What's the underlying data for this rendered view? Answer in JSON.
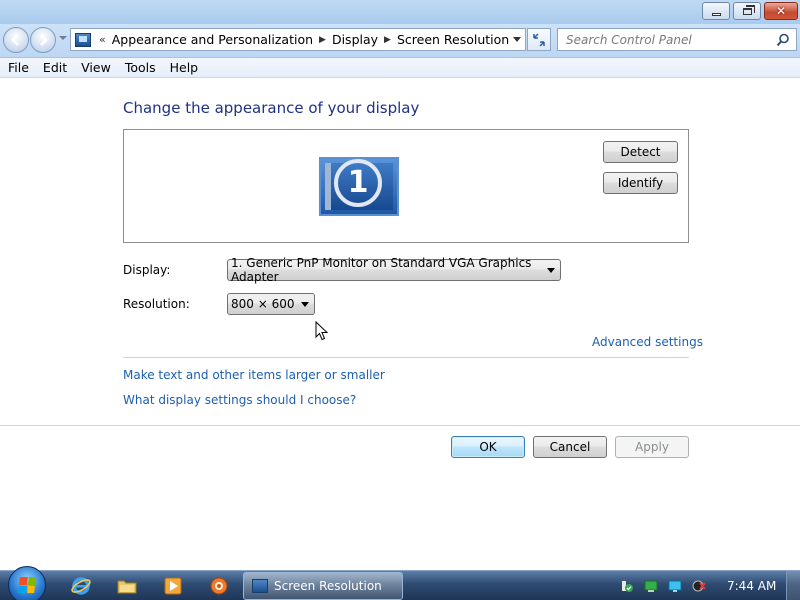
{
  "window": {
    "title_buttons": {
      "minimize_icon": "minimize-icon",
      "maximize_icon": "restore-icon",
      "close_icon": "close-icon"
    }
  },
  "address_bar": {
    "overflow_glyph": "«",
    "breadcrumb": [
      "Appearance and Personalization",
      "Display",
      "Screen Resolution"
    ]
  },
  "search": {
    "placeholder": "Search Control Panel"
  },
  "menu": [
    "File",
    "Edit",
    "View",
    "Tools",
    "Help"
  ],
  "main": {
    "heading": "Change the appearance of your display",
    "monitor_number": "1",
    "detect_label": "Detect",
    "identify_label": "Identify",
    "display_label": "Display:",
    "display_value": "1. Generic PnP Monitor on Standard VGA Graphics Adapter",
    "resolution_label": "Resolution:",
    "resolution_value": "800 × 600",
    "advanced_link": "Advanced settings",
    "link_text_size": "Make text and other items larger or smaller",
    "link_help": "What display settings should I choose?",
    "ok_label": "OK",
    "cancel_label": "Cancel",
    "apply_label": "Apply"
  },
  "taskbar": {
    "window_button": "Screen Resolution",
    "clock": "7:44 AM"
  },
  "colors": {
    "heading": "#1e3287",
    "link": "#1c5fb0",
    "taskbar": "#2f4b72"
  }
}
